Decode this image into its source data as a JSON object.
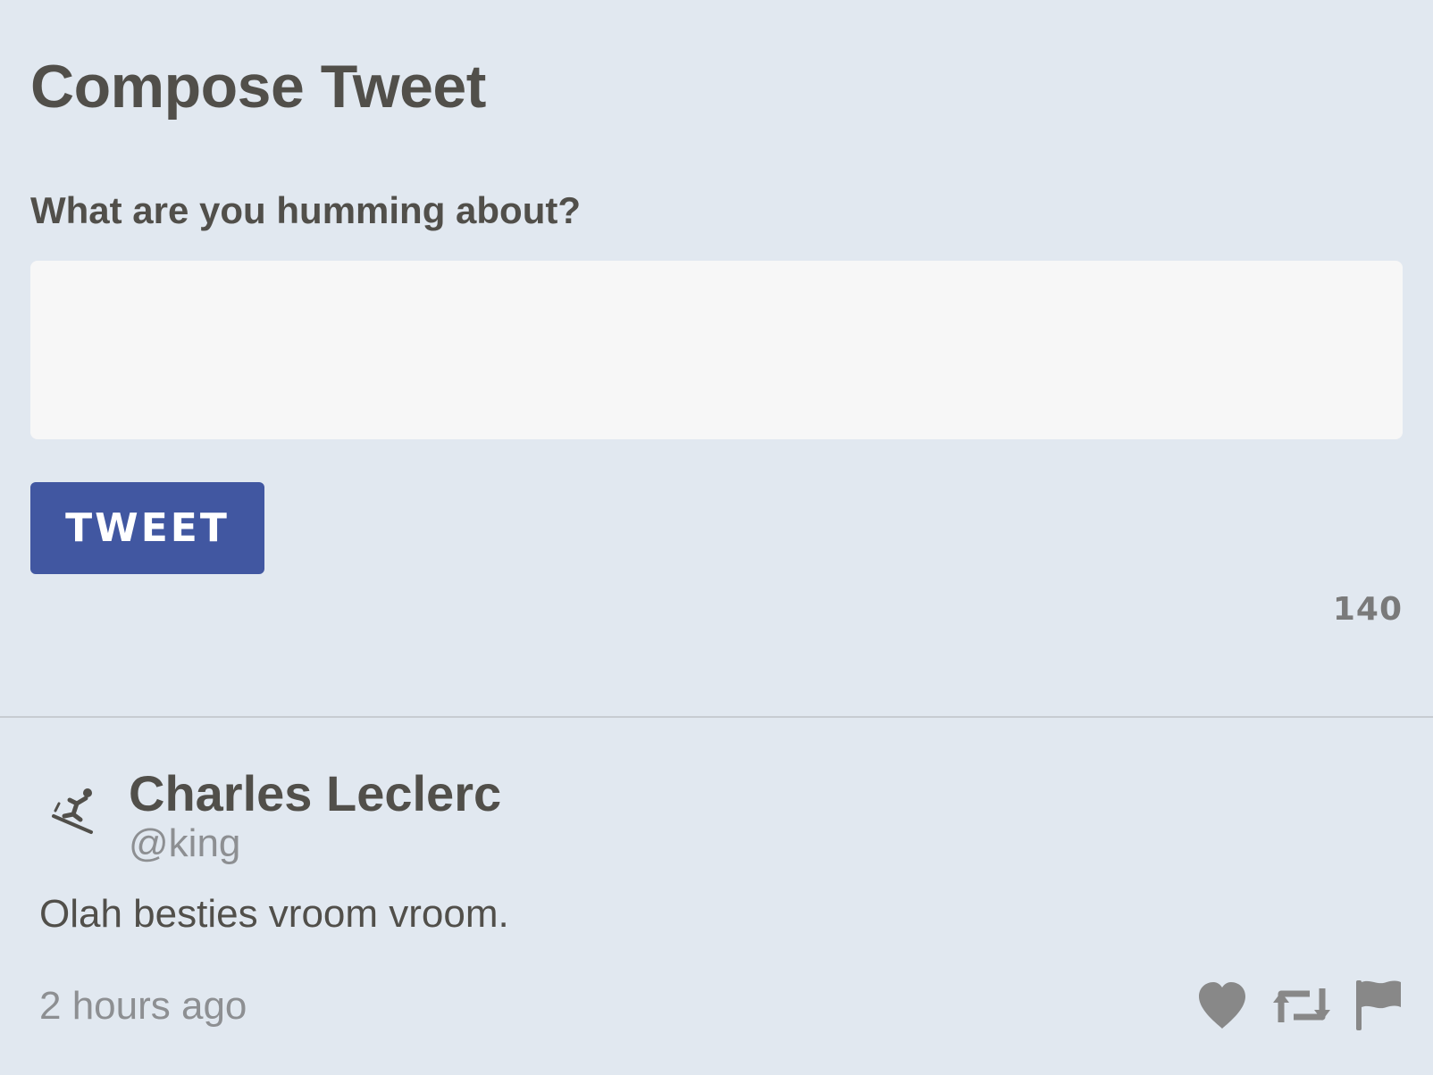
{
  "compose": {
    "title": "Compose Tweet",
    "label": "What are you humming about?",
    "input_value": "",
    "button_label": "TWEET",
    "char_count": "140"
  },
  "tweet": {
    "author_name": "Charles Leclerc",
    "author_handle": "@king",
    "avatar_icon": "snowboarder-icon",
    "text": "Olah besties vroom vroom.",
    "timestamp": "2 hours ago",
    "actions": [
      "heart-icon",
      "retweet-icon",
      "flag-icon"
    ]
  },
  "colors": {
    "background": "#e1e8f0",
    "button": "#4157a1",
    "input_background": "#f7f7f7",
    "text": "#514f4a",
    "muted": "#8d8f92",
    "icon": "#888888"
  }
}
